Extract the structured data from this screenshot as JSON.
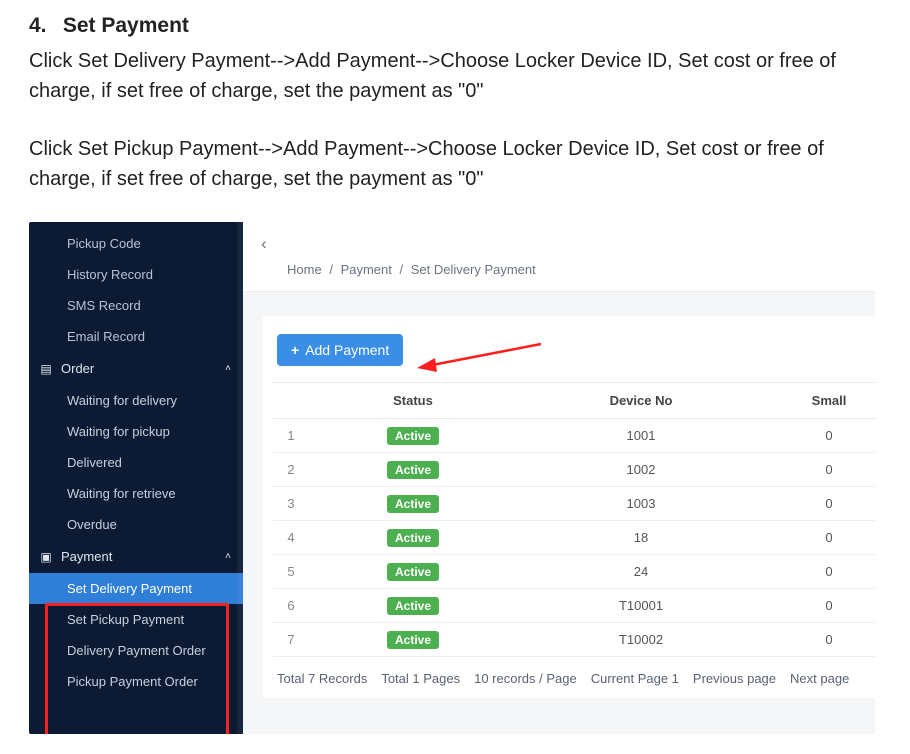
{
  "doc": {
    "heading_number": "4.",
    "heading_title": "Set Payment",
    "para1": "Click Set Delivery Payment-->Add Payment-->Choose Locker Device ID, Set cost or free of charge, if set free of charge, set the payment as \"0\"",
    "para2": "Click Set Pickup Payment-->Add Payment-->Choose Locker Device ID, Set cost or free of charge, if set free of charge, set the payment as \"0\""
  },
  "sidebar": {
    "top_items": [
      "Pickup Code",
      "History Record",
      "SMS Record",
      "Email Record"
    ],
    "order_group": {
      "label": "Order",
      "items": [
        "Waiting for delivery",
        "Waiting for pickup",
        "Delivered",
        "Waiting for retrieve",
        "Overdue"
      ]
    },
    "payment_group": {
      "label": "Payment",
      "items": [
        "Set Delivery Payment",
        "Set Pickup Payment",
        "Delivery Payment Order",
        "Pickup Payment Order"
      ],
      "selected_index": 0
    }
  },
  "breadcrumb": {
    "home": "Home",
    "section": "Payment",
    "page": "Set Delivery Payment"
  },
  "toolbar": {
    "add_payment_label": "Add Payment"
  },
  "table": {
    "columns": {
      "status": "Status",
      "device_no": "Device No",
      "small": "Small"
    },
    "rows": [
      {
        "idx": "1",
        "status": "Active",
        "device_no": "1001",
        "small": "0"
      },
      {
        "idx": "2",
        "status": "Active",
        "device_no": "1002",
        "small": "0"
      },
      {
        "idx": "3",
        "status": "Active",
        "device_no": "1003",
        "small": "0"
      },
      {
        "idx": "4",
        "status": "Active",
        "device_no": "18",
        "small": "0"
      },
      {
        "idx": "5",
        "status": "Active",
        "device_no": "24",
        "small": "0"
      },
      {
        "idx": "6",
        "status": "Active",
        "device_no": "T10001",
        "small": "0"
      },
      {
        "idx": "7",
        "status": "Active",
        "device_no": "T10002",
        "small": "0"
      }
    ]
  },
  "pager": {
    "total_records": "Total 7 Records",
    "total_pages": "Total 1 Pages",
    "per_page": "10 records / Page",
    "current": "Current Page 1",
    "prev": "Previous page",
    "next": "Next page"
  },
  "colors": {
    "sidebar_bg": "#0c1b33",
    "primary_blue": "#3a8ee6",
    "badge_green": "#4caf50",
    "callout_red": "#ff1f1f"
  }
}
